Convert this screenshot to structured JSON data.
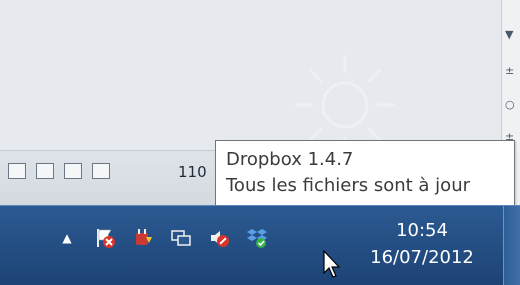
{
  "tooltip": {
    "title": "Dropbox 1.4.7",
    "status": "Tous les fichiers sont à jour"
  },
  "statusbar": {
    "zoom": "110"
  },
  "clock": {
    "time": "10:54",
    "date": "16/07/2012"
  },
  "tray_icons": [
    "overflow-arrow-icon",
    "action-center-flag-icon",
    "power-plug-icon",
    "network-icon",
    "volume-mute-icon",
    "dropbox-icon"
  ],
  "colors": {
    "taskbar": "#2b5a92",
    "tooltip_bg": "#ffffff",
    "tooltip_text": "#3b3b3b"
  }
}
